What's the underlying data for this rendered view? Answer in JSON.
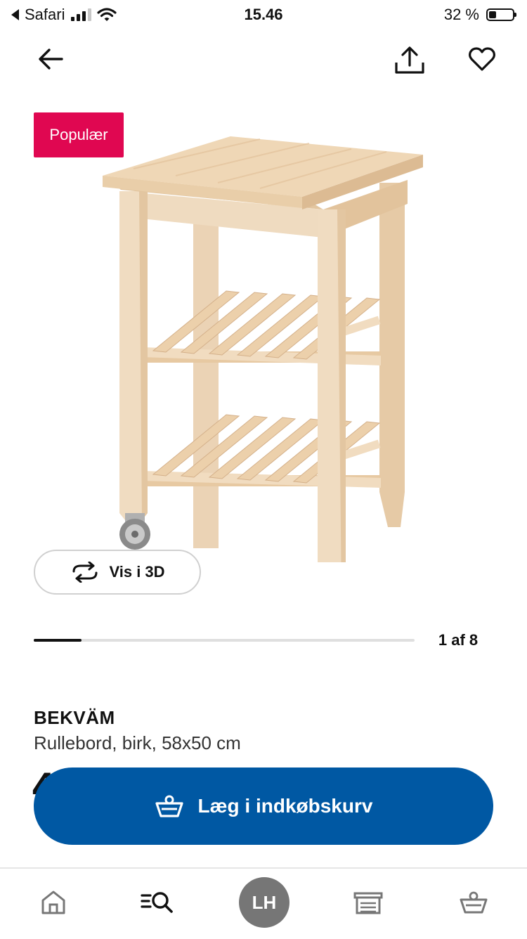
{
  "status_bar": {
    "back_app": "Safari",
    "time": "15.46",
    "battery": "32 %",
    "battery_level": 0.32
  },
  "top_nav": {
    "icons": [
      "back-arrow-icon",
      "share-icon",
      "heart-icon"
    ]
  },
  "product_image": {
    "badge": "Populær",
    "view_3d_label": "Vis i 3D"
  },
  "gallery": {
    "counter": "1 af 8",
    "progress_fraction": 0.125
  },
  "product": {
    "name": "BEKVÄM",
    "description": "Rullebord, birk, 58x50 cm",
    "price_peek": "4"
  },
  "cta": {
    "label": "Læg i indkøbskurv"
  },
  "bottom_nav": {
    "avatar_initials": "LH",
    "items": [
      "home-icon",
      "search-icon",
      "avatar",
      "store-icon",
      "basket-icon"
    ]
  },
  "colors": {
    "badge": "#e00751",
    "cta": "#0058a3",
    "avatar": "#767676"
  }
}
